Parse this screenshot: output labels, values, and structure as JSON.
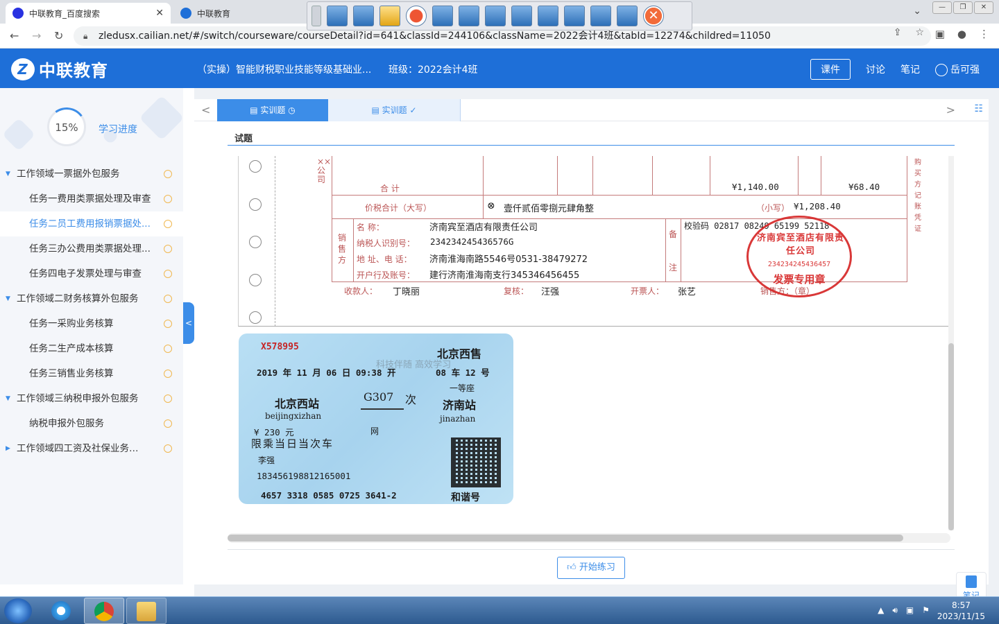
{
  "browser": {
    "tabs": [
      {
        "title": "中联教育_百度搜索"
      },
      {
        "title": "中联教育"
      }
    ],
    "url": "zledusx.cailian.net/#/switch/courseware/courseDetail?id=641&classId=244106&className=2022会计4班&tabId=12274&childred=11050"
  },
  "header": {
    "logo_text": "中联教育",
    "course_title": "（实操）智能财税职业技能等级基础业...",
    "class_label": "班级：2022会计4班",
    "nav": [
      "课件",
      "讨论",
      "笔记"
    ],
    "user": "岳可强"
  },
  "sidebar": {
    "progress_value": "15%",
    "progress_fraction": 0.15,
    "progress_label": "学习进度",
    "items": [
      {
        "type": "group",
        "label": "工作领域一票据外包服务"
      },
      {
        "type": "task",
        "label": "任务一费用类票据处理及审查"
      },
      {
        "type": "task",
        "label": "任务二员工费用报销票据处...",
        "active": true
      },
      {
        "type": "task",
        "label": "任务三办公费用类票据处理..."
      },
      {
        "type": "task",
        "label": "任务四电子发票处理与审查"
      },
      {
        "type": "group",
        "label": "工作领域二财务核算外包服务"
      },
      {
        "type": "task",
        "label": "任务一采购业务核算"
      },
      {
        "type": "task",
        "label": "任务二生产成本核算"
      },
      {
        "type": "task",
        "label": "任务三销售业务核算"
      },
      {
        "type": "group",
        "label": "工作领域三纳税申报外包服务"
      },
      {
        "type": "task",
        "label": "纳税申报外包服务"
      },
      {
        "type": "group",
        "label": "工作领域四工资及社保业务外...",
        "collapsed": true
      }
    ]
  },
  "question_tabs": [
    "实训题",
    "实训题"
  ],
  "section_title": "试题",
  "invoice": {
    "company_vertical": "××公司",
    "right_vertical": "购买方记账凭证",
    "total_label": "合 计",
    "total_amount": "¥1,140.00",
    "total_tax": "¥68.40",
    "grand_label": "价税合计（大写）",
    "grand_upper": "壹仟贰佰零捌元肆角整",
    "grand_lower_label": "（小写）",
    "grand_lower": "¥1,208.40",
    "seller_label": "销售方",
    "name_label": "名 称：",
    "name_value": "济南宾至酒店有限责任公司",
    "taxid_label": "纳税人识别号：",
    "taxid_value": "234234245436576G",
    "addr_label": "地 址、电 话：",
    "addr_value": "济南淮海南路5546号0531-38479272",
    "bank_label": "开户行及账号：",
    "bank_value": "建行济南淮海南支行345346456455",
    "remark_label_1": "备",
    "remark_label_2": "注",
    "check_code": "校验码 02817 08249 65199 52118",
    "payee_label": "收款人：",
    "payee": "丁晓丽",
    "reviewer_label": "复核：",
    "reviewer": "汪强",
    "drawer_label": "开票人：",
    "drawer": "张艺",
    "seller_sign_label": "销售方：（章）",
    "stamp_name": "济南宾至酒店有限责任公司",
    "stamp_id": "234234245436457",
    "stamp_type": "发票专用章"
  },
  "ticket": {
    "serial": "X578995",
    "watermark": "科技伴随 高效学习",
    "sale_station": "北京西售",
    "date": "2019 年 11 月 06 日 09:38 开",
    "seat": "08 车 12 号",
    "seat_class": "一等座",
    "from_cn": "北京西站",
    "from_py": "beijingxizhan",
    "train_no": "G307",
    "train_suffix": "次",
    "to_cn": "济南站",
    "to_py": "jinazhan",
    "price": "¥ 230 元",
    "channel": "网",
    "notice": "限乘当日当次车",
    "passenger": "李强",
    "id_no": "183456198812165001",
    "ticket_code": "4657 3318 0585 0725 3641-2",
    "brand": "和谐号"
  },
  "start_button": "开始练习",
  "note_button": "笔记",
  "taskbar": {
    "time": "8:57",
    "date": "2023/11/15"
  },
  "colors": {
    "header_blue": "#1e6fd8",
    "accent": "#3c8de8",
    "invoice_red": "#c47a7a",
    "stamp_red": "#d62828"
  }
}
